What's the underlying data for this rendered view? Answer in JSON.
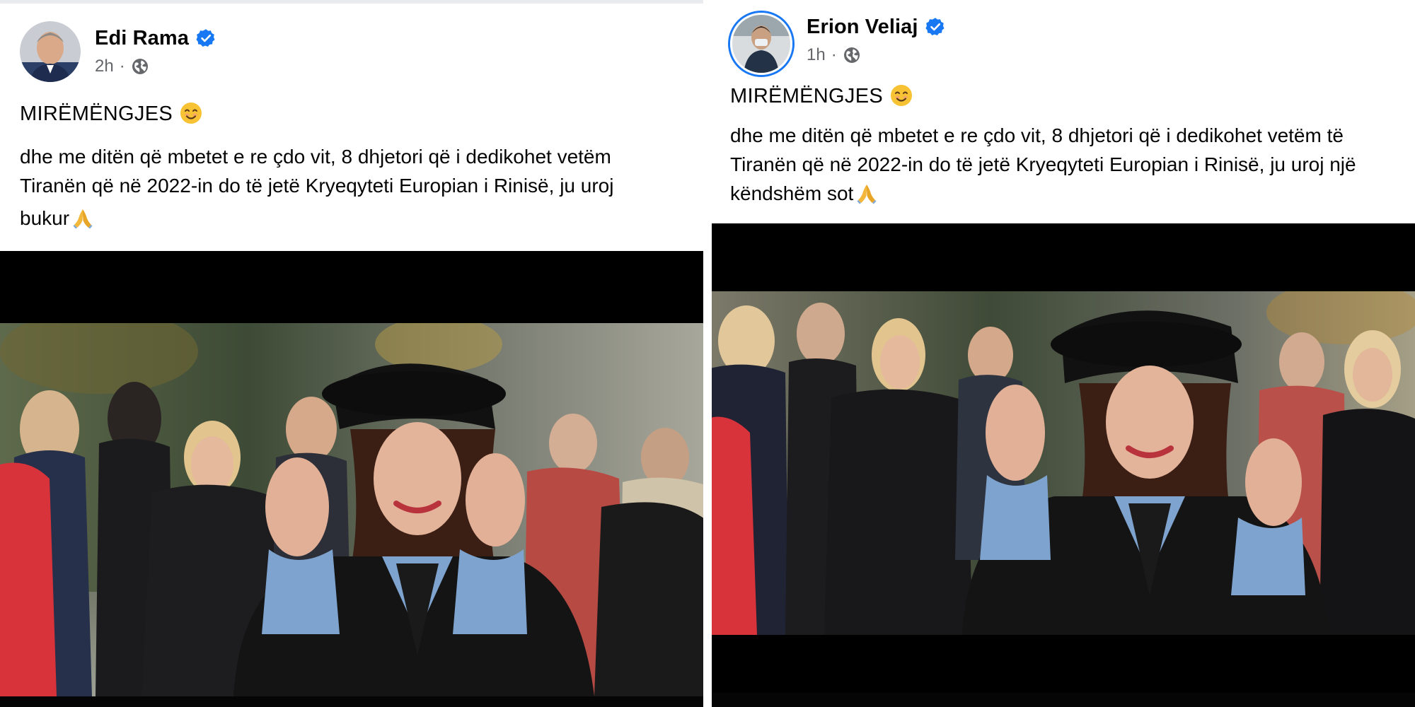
{
  "left_post": {
    "author_name": "Edi Rama",
    "time_ago": "2h",
    "separator": "·",
    "headline": "MIRËMËNGJES",
    "body_lines": [
      "dhe me ditën që mbetet e re çdo vit, 8 dhjetori që i dedikohet vetëm",
      "Tiranën që në 2022-in do të jetë Kryeqyteti Europian i Rinisë, ju uroj",
      "bukur"
    ],
    "icons": {
      "avatar": "profile-photo-avatar",
      "verified": "verified-badge-icon",
      "audience": "globe-icon",
      "headline_emoji": "smiling-face-emoji",
      "closing_emoji": "folded-hands-emoji"
    }
  },
  "right_post": {
    "author_name": "Erion Veliaj",
    "time_ago": "1h",
    "separator": "·",
    "headline": "MIRËMËNGJES",
    "body_lines": [
      "dhe me ditën që mbetet e re çdo vit, 8 dhjetori që i dedikohet vetëm të",
      "Tiranën që në 2022-in do të jetë Kryeqyteti Europian i Rinisë, ju uroj një",
      "këndshëm sot"
    ],
    "icons": {
      "avatar": "profile-photo-avatar-with-story-ring",
      "verified": "verified-badge-icon",
      "audience": "globe-icon",
      "headline_emoji": "smiling-face-emoji",
      "closing_emoji": "folded-hands-emoji"
    }
  },
  "colors": {
    "name_text": "#050505",
    "meta_text": "#65676b",
    "verified_blue": "#1877f2",
    "video_letterbox": "#000000"
  }
}
